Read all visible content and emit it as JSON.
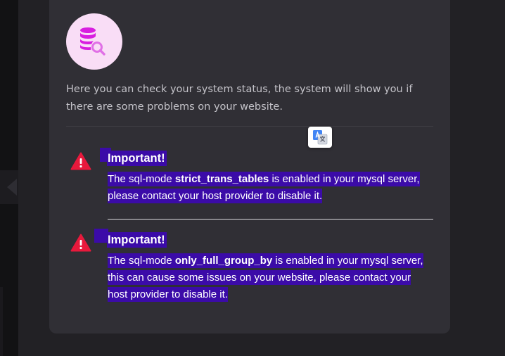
{
  "intro": {
    "text": "Here you can check your system status, the system will show you if there are some problems on your website."
  },
  "icons": {
    "status": "database-search-icon",
    "translate": "google-translate-icon",
    "alert": "warning-triangle-icon"
  },
  "alerts": [
    {
      "title": "Important!",
      "prefix": "The sql-mode ",
      "mode": "strict_trans_tables",
      "suffix": " is enabled in your mysql server, please contact your host provider to disable it."
    },
    {
      "title": "Important!",
      "prefix": "The sql-mode ",
      "mode": "only_full_group_by",
      "suffix": " is enabled in your mysql server, this can cause some issues on your website, please contact your host provider to disable it."
    }
  ],
  "colors": {
    "background": "#222125",
    "card": "#302f35",
    "icon_circle": "#f9ddf6",
    "icon_accent": "#d81ee0",
    "alert_red": "#e8193c",
    "selection": "#3b0ba8"
  }
}
